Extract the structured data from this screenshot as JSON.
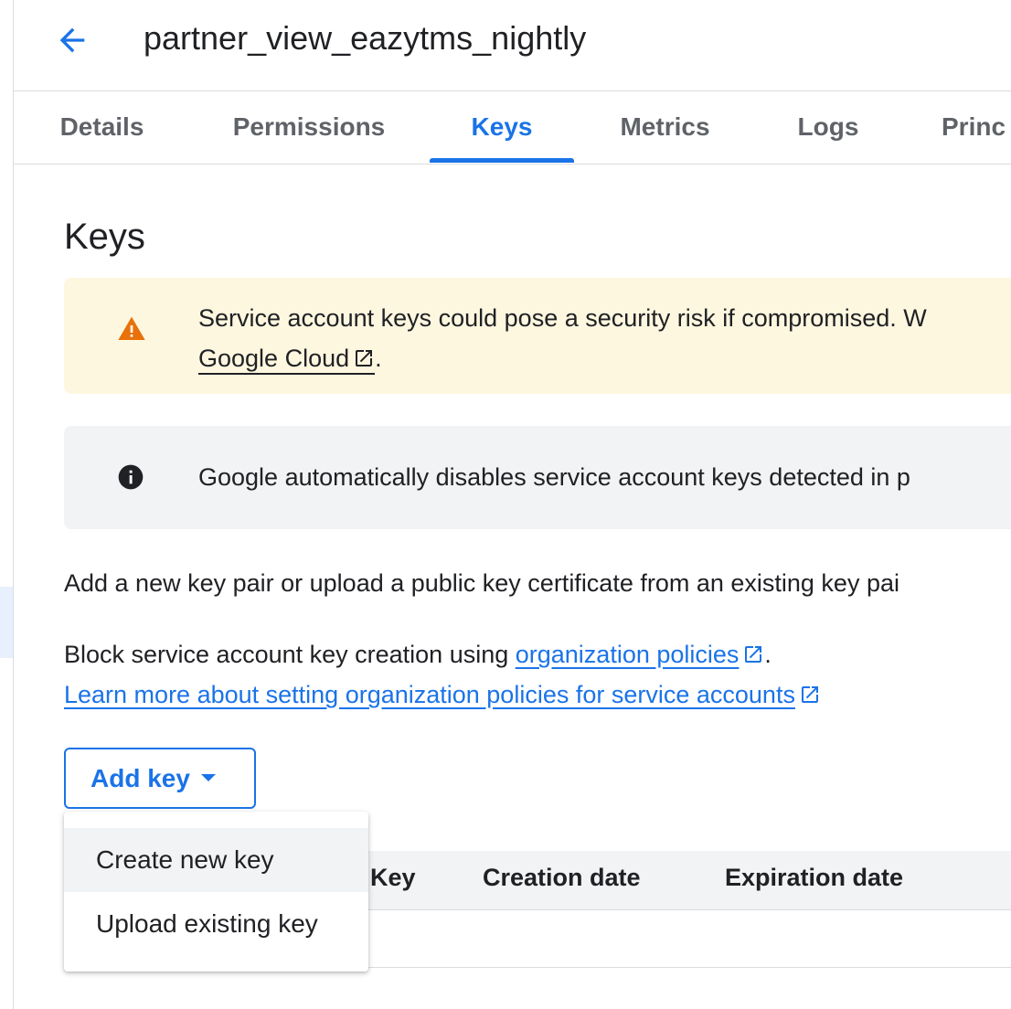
{
  "header": {
    "title": "partner_view_eazytms_nightly"
  },
  "tabs": [
    {
      "label": "Details"
    },
    {
      "label": "Permissions"
    },
    {
      "label": "Keys",
      "active": true
    },
    {
      "label": "Metrics"
    },
    {
      "label": "Logs"
    },
    {
      "label": "Princ"
    }
  ],
  "section": {
    "title": "Keys"
  },
  "warning_banner": {
    "text": "Service account keys could pose a security risk if compromised. W",
    "link": "Google Cloud",
    "suffix": "."
  },
  "info_banner": {
    "text": "Google automatically disables service account keys detected in p"
  },
  "description": {
    "line1": "Add a new key pair or upload a public key certificate from an existing key pai",
    "line2_prefix": "Block service account key creation using ",
    "line2_link": "organization policies",
    "line2_suffix": ".",
    "line3_link": "Learn more about setting organization policies for service accounts"
  },
  "add_key_button": {
    "label": "Add key"
  },
  "add_key_menu": {
    "items": [
      {
        "label": "Create new key"
      },
      {
        "label": "Upload existing key"
      }
    ]
  },
  "table": {
    "columns": [
      "Key",
      "Creation date",
      "Expiration date"
    ]
  },
  "colors": {
    "accent": "#1a73e8",
    "warning_bg": "#fef7e0",
    "warning_icon": "#e8710a",
    "info_bg": "#f1f3f4"
  }
}
